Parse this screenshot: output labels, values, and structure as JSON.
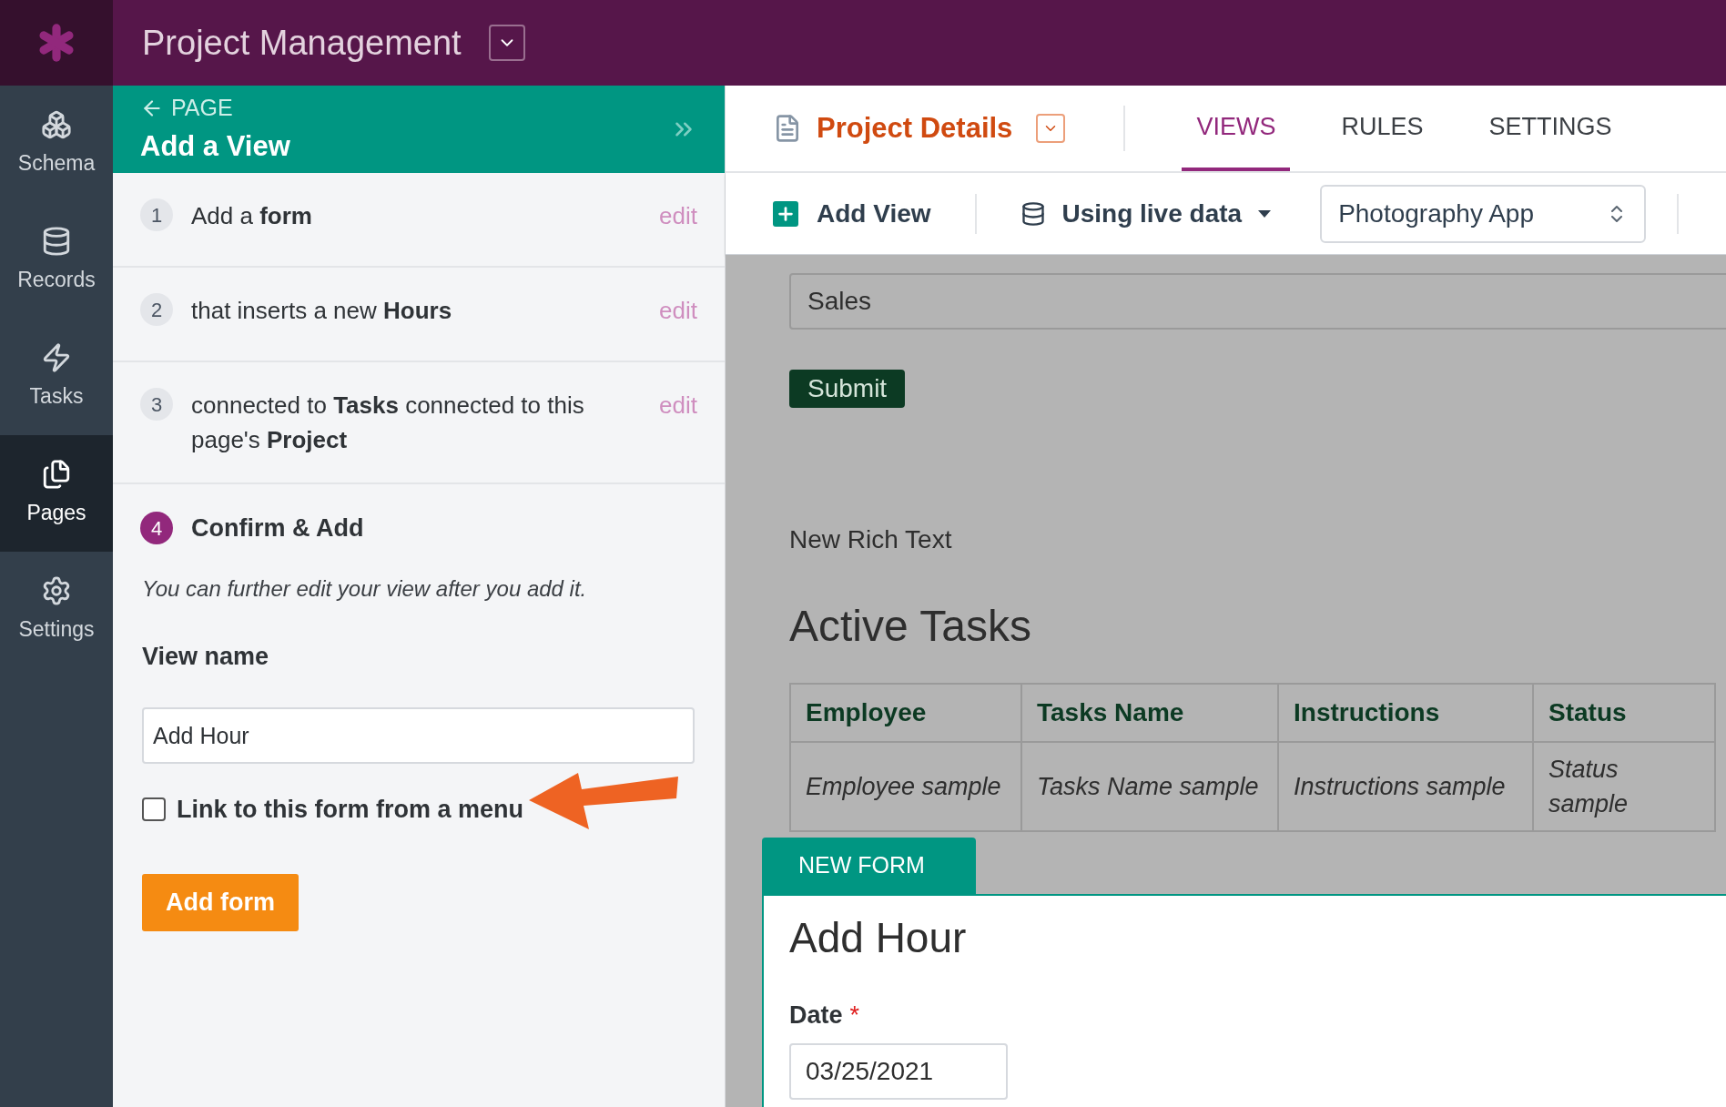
{
  "app": {
    "title": "Project Management"
  },
  "nav": [
    {
      "label": "Schema",
      "selected": false
    },
    {
      "label": "Records",
      "selected": false
    },
    {
      "label": "Tasks",
      "selected": false
    },
    {
      "label": "Pages",
      "selected": true
    },
    {
      "label": "Settings",
      "selected": false
    }
  ],
  "panel": {
    "back": "PAGE",
    "title": "Add a View",
    "steps": [
      {
        "number": "1",
        "text": "Add a **form**",
        "action": "edit",
        "active": false
      },
      {
        "number": "2",
        "text": "that inserts a new **Hours**",
        "action": "edit",
        "active": false
      },
      {
        "number": "3",
        "text": "connected to **Tasks** connected to this page's **Project**",
        "action": "edit",
        "active": false
      },
      {
        "number": "4",
        "text": "Confirm & Add",
        "active": true
      }
    ],
    "hint": "You can further edit your view after you add it.",
    "view_name_label": "View name",
    "view_name": "Add Hour",
    "link_checkbox": {
      "label": "Link to this form from a menu",
      "checked": false
    },
    "submit": "Add form"
  },
  "header": {
    "page": "Project Details",
    "tabs": [
      {
        "label": "VIEWS",
        "selected": true
      },
      {
        "label": "RULES",
        "selected": false
      },
      {
        "label": "SETTINGS",
        "selected": false
      }
    ]
  },
  "toolbar": {
    "add_view": "Add View",
    "data_source": "Using live data",
    "app_select": "Photography App"
  },
  "preview": {
    "status_value": "Sales",
    "submit": "Submit",
    "rich_text": "New Rich Text",
    "table_title": "Active Tasks",
    "columns": [
      "Employee",
      "Tasks Name",
      "Instructions",
      "Status"
    ],
    "rows": [
      [
        "Employee sample",
        "Tasks Name sample",
        "Instructions sample",
        "Status sample"
      ]
    ],
    "new_form": {
      "tab": "NEW FORM",
      "title": "Add Hour",
      "field_label": "Date",
      "required_mark": "*",
      "field_value": "03/25/2021"
    }
  }
}
